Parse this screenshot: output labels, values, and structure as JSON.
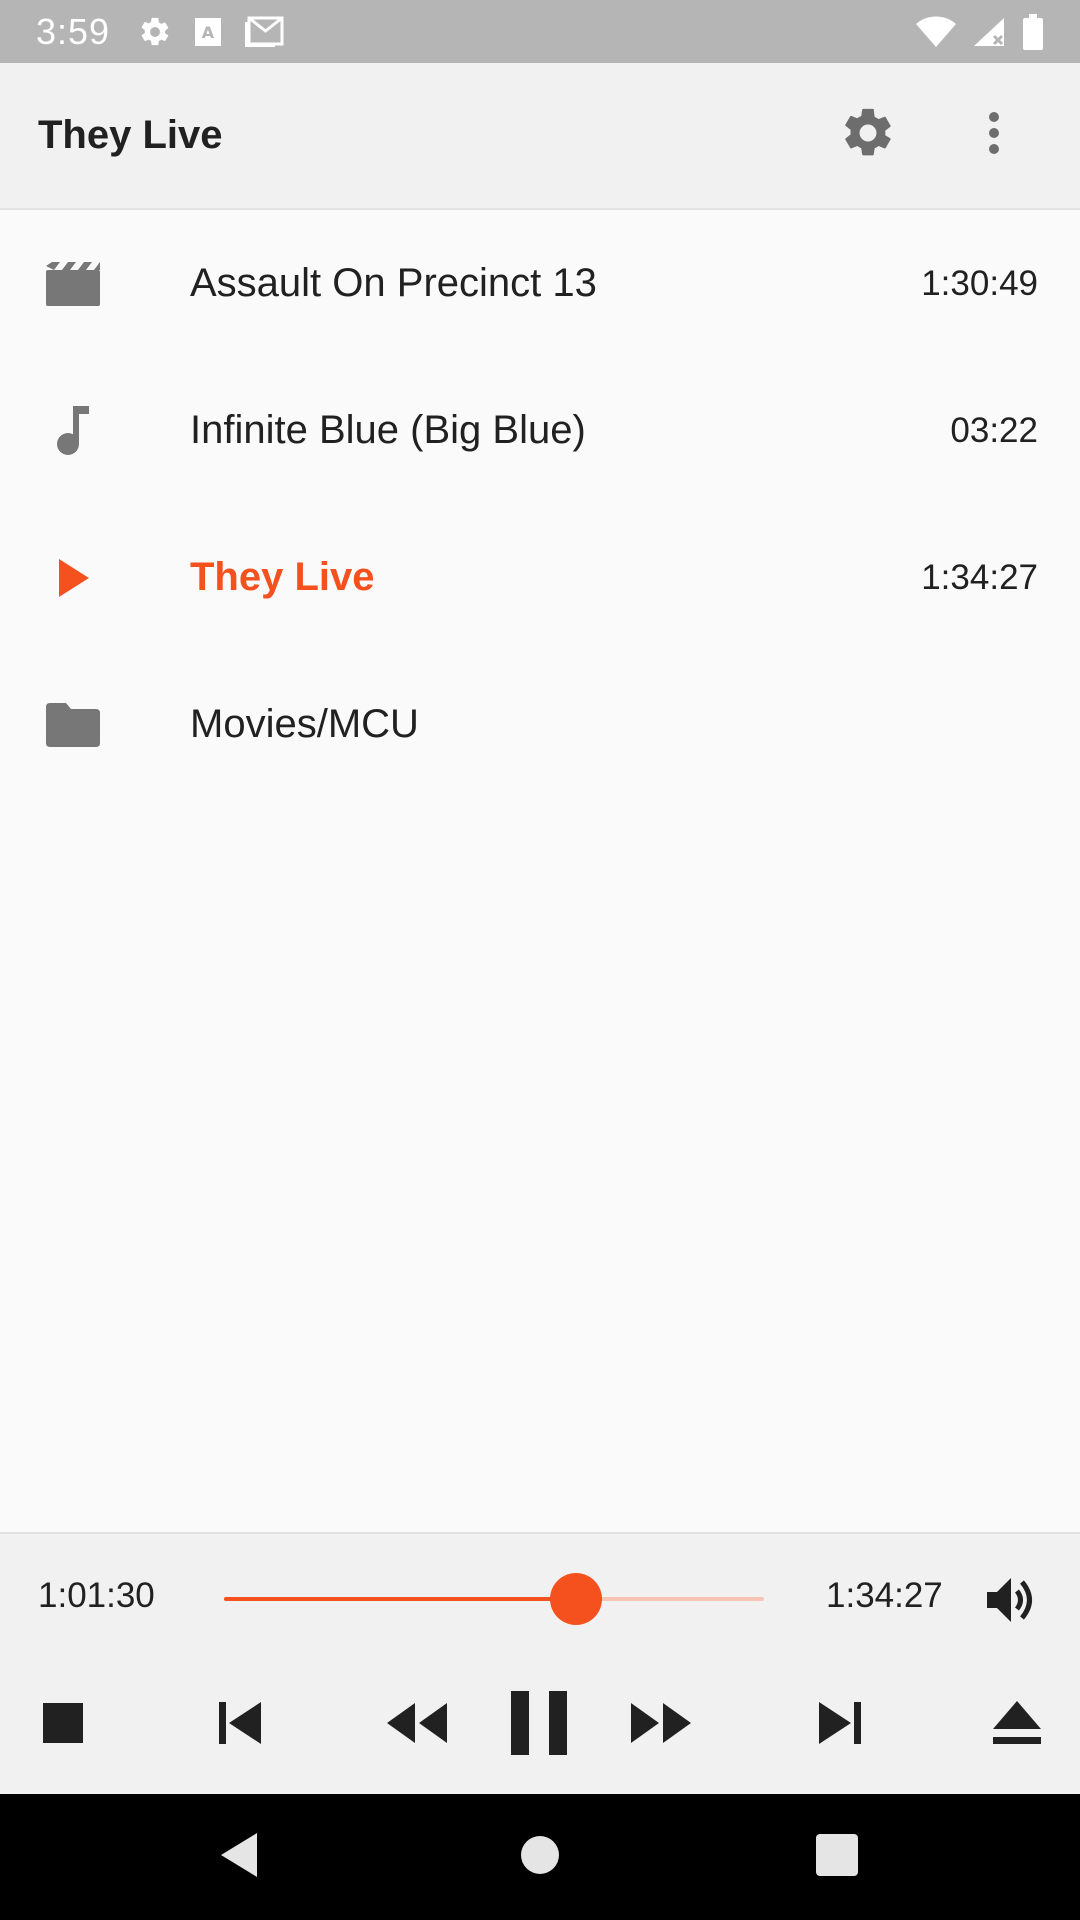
{
  "status_bar": {
    "time": "3:59",
    "left_icons": [
      "settings-icon",
      "font-icon",
      "gmail-icon"
    ],
    "right_icons": [
      "wifi-icon",
      "signal-icon",
      "battery-icon"
    ]
  },
  "app_bar": {
    "title": "They Live",
    "actions": [
      "settings-icon",
      "more-vert-icon"
    ]
  },
  "list": {
    "items": [
      {
        "icon": "movie-icon",
        "label": "Assault On Precinct 13",
        "duration": "1:30:49",
        "active": false
      },
      {
        "icon": "music-note-icon",
        "label": "Infinite Blue (Big Blue)",
        "duration": "03:22",
        "active": false
      },
      {
        "icon": "play-icon",
        "label": "They Live",
        "duration": "1:34:27",
        "active": true
      },
      {
        "icon": "folder-icon",
        "label": "Movies/MCU",
        "duration": "",
        "active": false
      }
    ]
  },
  "player": {
    "current_time": "1:01:30",
    "total_time": "1:34:27",
    "progress_fraction": 0.651,
    "controls": [
      "stop-icon",
      "skip-previous-icon",
      "rewind-icon",
      "pause-icon",
      "fast-forward-icon",
      "skip-next-icon",
      "eject-icon"
    ]
  },
  "colors": {
    "accent": "#f4511e",
    "icon_gray": "#777777",
    "status_bar": "#b5b5b5",
    "app_bar": "#f1f1f1",
    "background": "#fafafa"
  }
}
